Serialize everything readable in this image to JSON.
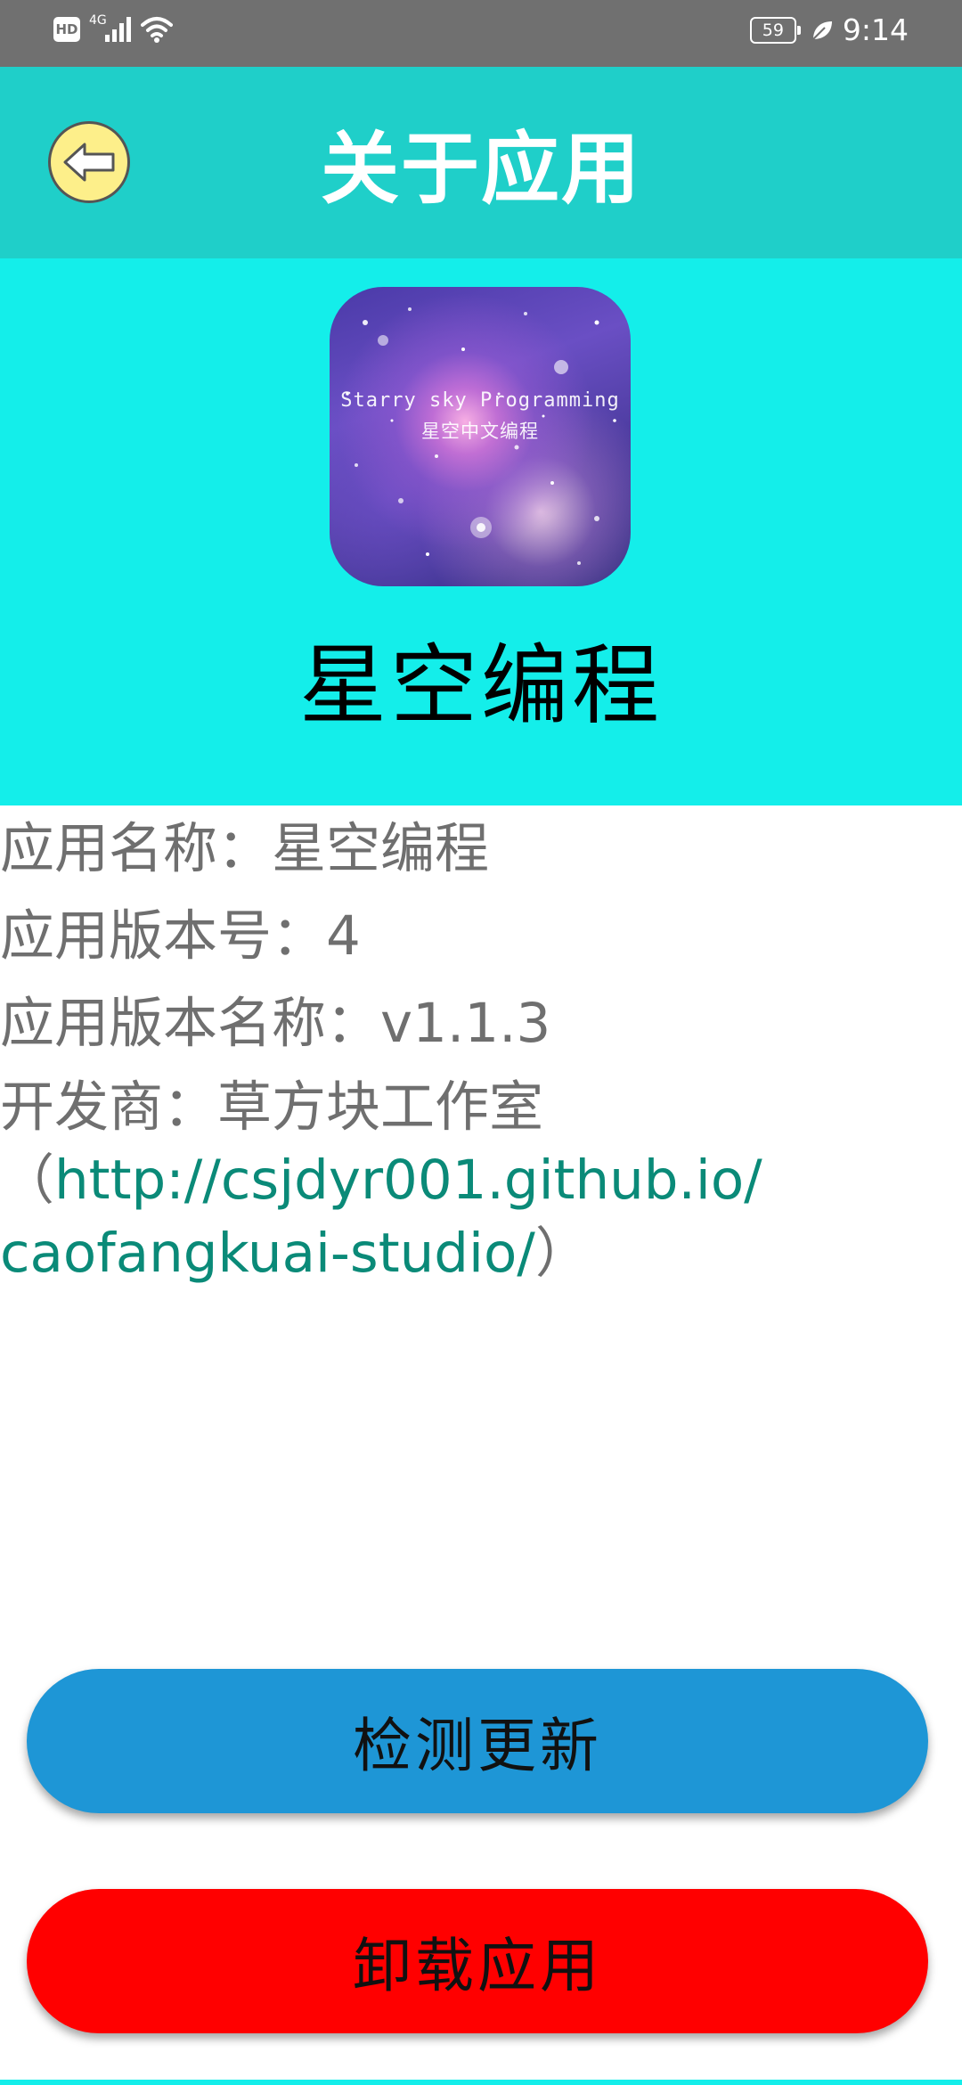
{
  "status_bar": {
    "hd_badge": "HD",
    "network_type": "4G",
    "battery_level": "59",
    "time": "9:14",
    "icons": [
      "signal-icon",
      "wifi-icon",
      "battery-icon",
      "leaf-icon"
    ]
  },
  "header": {
    "title": "关于应用",
    "back_icon": "back-arrow-icon"
  },
  "app_icon": {
    "text_en": "Starry sky Programming",
    "text_zh": "星空中文编程"
  },
  "app_display_name": "星空编程",
  "info": {
    "name_label": "应用名称：",
    "name_value": "星空编程",
    "version_code_label": "应用版本号：",
    "version_code_value": "4",
    "version_name_label": "应用版本名称：",
    "version_name_value": "v1.1.3",
    "developer_label": "开发商：",
    "developer_value": "草方块工作室",
    "developer_paren_open": "（",
    "developer_url_part1": "http://csjdyr001.github.io/",
    "developer_url_part2": "caofangkuai-studio/",
    "developer_paren_close": "）"
  },
  "buttons": {
    "check_update": "检测更新",
    "uninstall": "卸载应用"
  },
  "colors": {
    "status_bar": "#707070",
    "title_bar": "#1fcfc9",
    "header_bg": "#14eeea",
    "link": "#0a8a78",
    "update_button": "#1e96d6",
    "uninstall_button": "#ff0000",
    "back_button": "#fdef8a"
  }
}
